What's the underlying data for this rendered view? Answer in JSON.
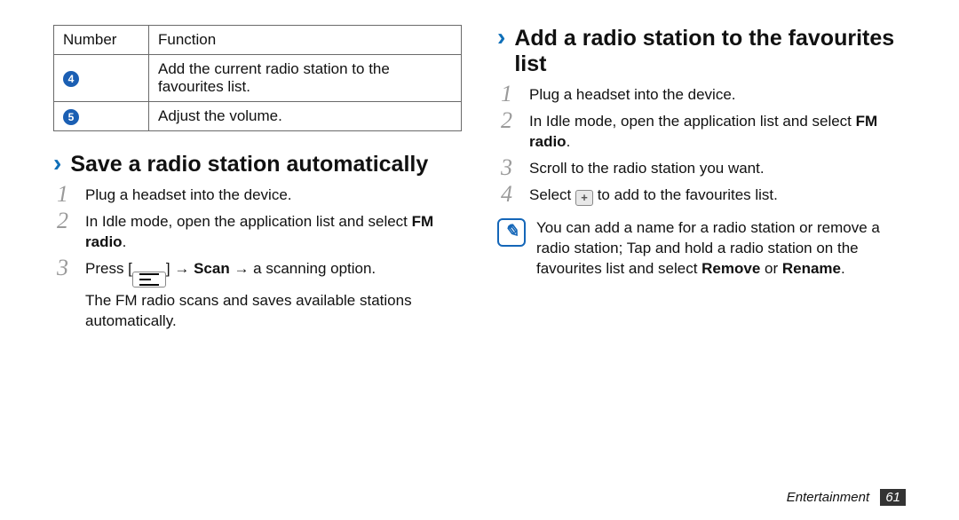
{
  "table": {
    "headers": {
      "number": "Number",
      "function": "Function"
    },
    "rows": [
      {
        "num": "4",
        "func": "Add the current radio station to the favourites list."
      },
      {
        "num": "5",
        "func": "Adjust the volume."
      }
    ]
  },
  "section_save": {
    "chevron": "›",
    "title": "Save a radio station automatically",
    "steps": {
      "s1": "Plug a headset into the device.",
      "s2_a": "In Idle mode, open the application list and select ",
      "s2_b": "FM radio",
      "s2_c": ".",
      "s3_a": "Press [",
      "s3_b": "] → ",
      "s3_c": "Scan",
      "s3_d": " → a scanning option.",
      "s3_after": "The FM radio scans and saves available stations automatically."
    }
  },
  "section_add": {
    "chevron": "›",
    "title": "Add a radio station to the favourites list",
    "steps": {
      "s1": "Plug a headset into the device.",
      "s2_a": "In Idle mode, open the application list and select ",
      "s2_b": "FM radio",
      "s2_c": ".",
      "s3": "Scroll to the radio station you want.",
      "s4_a": "Select ",
      "s4_b": " to add to the favourites list."
    },
    "note_a": "You can add a name for a radio station or remove a radio station; Tap and hold a radio station on the favourites list and select ",
    "note_b": "Remove",
    "note_c": " or ",
    "note_d": "Rename",
    "note_e": "."
  },
  "step_numbers": {
    "n1": "1",
    "n2": "2",
    "n3": "3",
    "n4": "4"
  },
  "footer": {
    "chapter": "Entertainment",
    "page": "61"
  }
}
